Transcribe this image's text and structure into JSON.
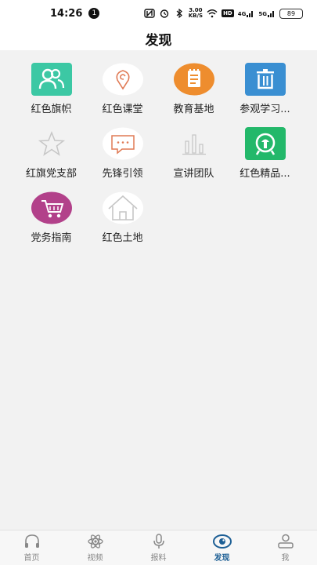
{
  "status_bar": {
    "time": "14:26",
    "notification_count": "1",
    "net_speed_value": "3.00",
    "net_speed_unit": "KB/S",
    "hd_label": "HD",
    "signal_1": "4G",
    "signal_2": "5G",
    "battery": "89"
  },
  "header": {
    "title": "发现"
  },
  "grid": {
    "items": [
      {
        "label": "红色旗帜",
        "icon": "people-icon",
        "color": "#3cc8a4"
      },
      {
        "label": "红色课堂",
        "icon": "location-pin-icon",
        "color": "#e07a55"
      },
      {
        "label": "教育基地",
        "icon": "notebook-icon",
        "color": "#ee8d2e"
      },
      {
        "label": "参观学习...",
        "icon": "trash-icon",
        "color": "#3a8fd2"
      },
      {
        "label": "红旗党支部",
        "icon": "star-icon",
        "color": "#c0c0c0"
      },
      {
        "label": "先锋引领",
        "icon": "chat-icon",
        "color": "#e07a55"
      },
      {
        "label": "宣讲团队",
        "icon": "bar-chart-icon",
        "color": "#c0c0c0"
      },
      {
        "label": "红色精品...",
        "icon": "railway-icon",
        "color": "#23b86a"
      },
      {
        "label": "党务指南",
        "icon": "cart-icon",
        "color": "#b2418a"
      },
      {
        "label": "红色土地",
        "icon": "home-icon",
        "color": "#c0c0c0"
      }
    ]
  },
  "tab_bar": {
    "active_color": "#1d5f95",
    "tabs": [
      {
        "label": "首页",
        "icon": "headphones-icon"
      },
      {
        "label": "视频",
        "icon": "atom-icon"
      },
      {
        "label": "报料",
        "icon": "microphone-icon"
      },
      {
        "label": "发现",
        "icon": "eye-icon"
      },
      {
        "label": "我",
        "icon": "user-icon"
      }
    ]
  }
}
